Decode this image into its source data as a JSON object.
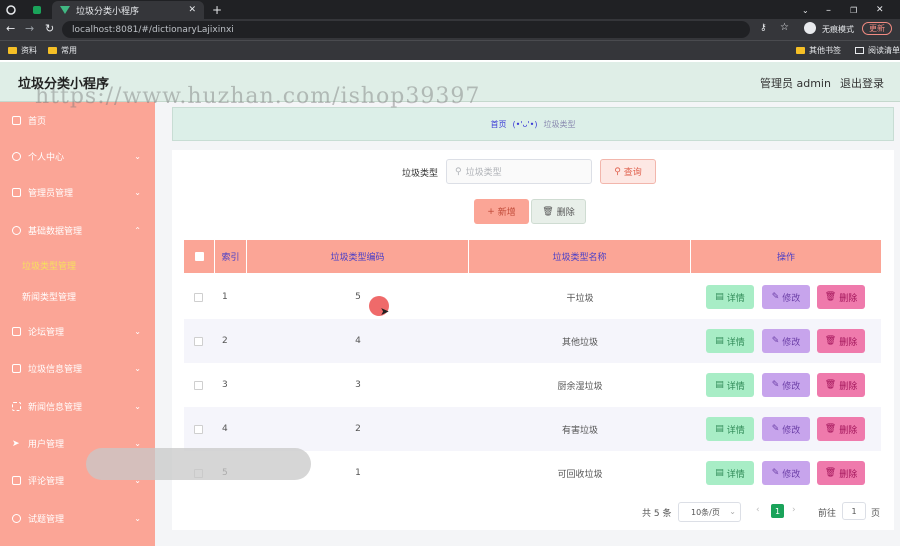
{
  "browser": {
    "tab_title": "垃圾分类小程序",
    "url": "localhost:8081/#/dictionaryLajixinxi",
    "incognito_label": "无痕模式",
    "update_label": "更新",
    "bookmarks": [
      "资料",
      "常用"
    ],
    "bookmarks_right": [
      "其他书签",
      "阅读清单"
    ]
  },
  "header": {
    "title": "垃圾分类小程序",
    "admin": "管理员 admin",
    "logout": "退出登录"
  },
  "watermark": "https://www.huzhan.com/ishop39397",
  "sidebar": {
    "items": [
      {
        "label": "首页"
      },
      {
        "label": "个人中心"
      },
      {
        "label": "管理员管理"
      },
      {
        "label": "基础数据管理"
      },
      {
        "label": "论坛管理"
      },
      {
        "label": "垃圾信息管理"
      },
      {
        "label": "新闻信息管理"
      },
      {
        "label": "用户管理"
      },
      {
        "label": "评论管理"
      },
      {
        "label": "试题管理"
      }
    ],
    "sub_items": [
      {
        "label": "垃圾类型管理",
        "active": true
      },
      {
        "label": "新闻类型管理",
        "active": false
      }
    ]
  },
  "breadcrumb": {
    "home": "首页",
    "face": "(•'ᴗ'•)",
    "current": "垃圾类型"
  },
  "search": {
    "label": "垃圾类型",
    "placeholder": "垃圾类型",
    "query_label": "查询"
  },
  "actions": {
    "add_label": "新增",
    "delete_label": "删除"
  },
  "table": {
    "headers": [
      "索引",
      "垃圾类型编码",
      "垃圾类型名称",
      "操作"
    ],
    "rows": [
      {
        "index": "1",
        "code": "5",
        "name": "干垃圾"
      },
      {
        "index": "2",
        "code": "4",
        "name": "其他垃圾"
      },
      {
        "index": "3",
        "code": "3",
        "name": "厨余湿垃圾"
      },
      {
        "index": "4",
        "code": "2",
        "name": "有害垃圾"
      },
      {
        "index": "5",
        "code": "1",
        "name": "可回收垃圾"
      }
    ],
    "row_buttons": {
      "detail": "详情",
      "edit": "修改",
      "delete": "删除"
    }
  },
  "pagination": {
    "total": "共 5 条",
    "page_size": "10条/页",
    "current_page": "1",
    "goto_label": "前往",
    "goto_value": "1",
    "page_unit": "页"
  }
}
